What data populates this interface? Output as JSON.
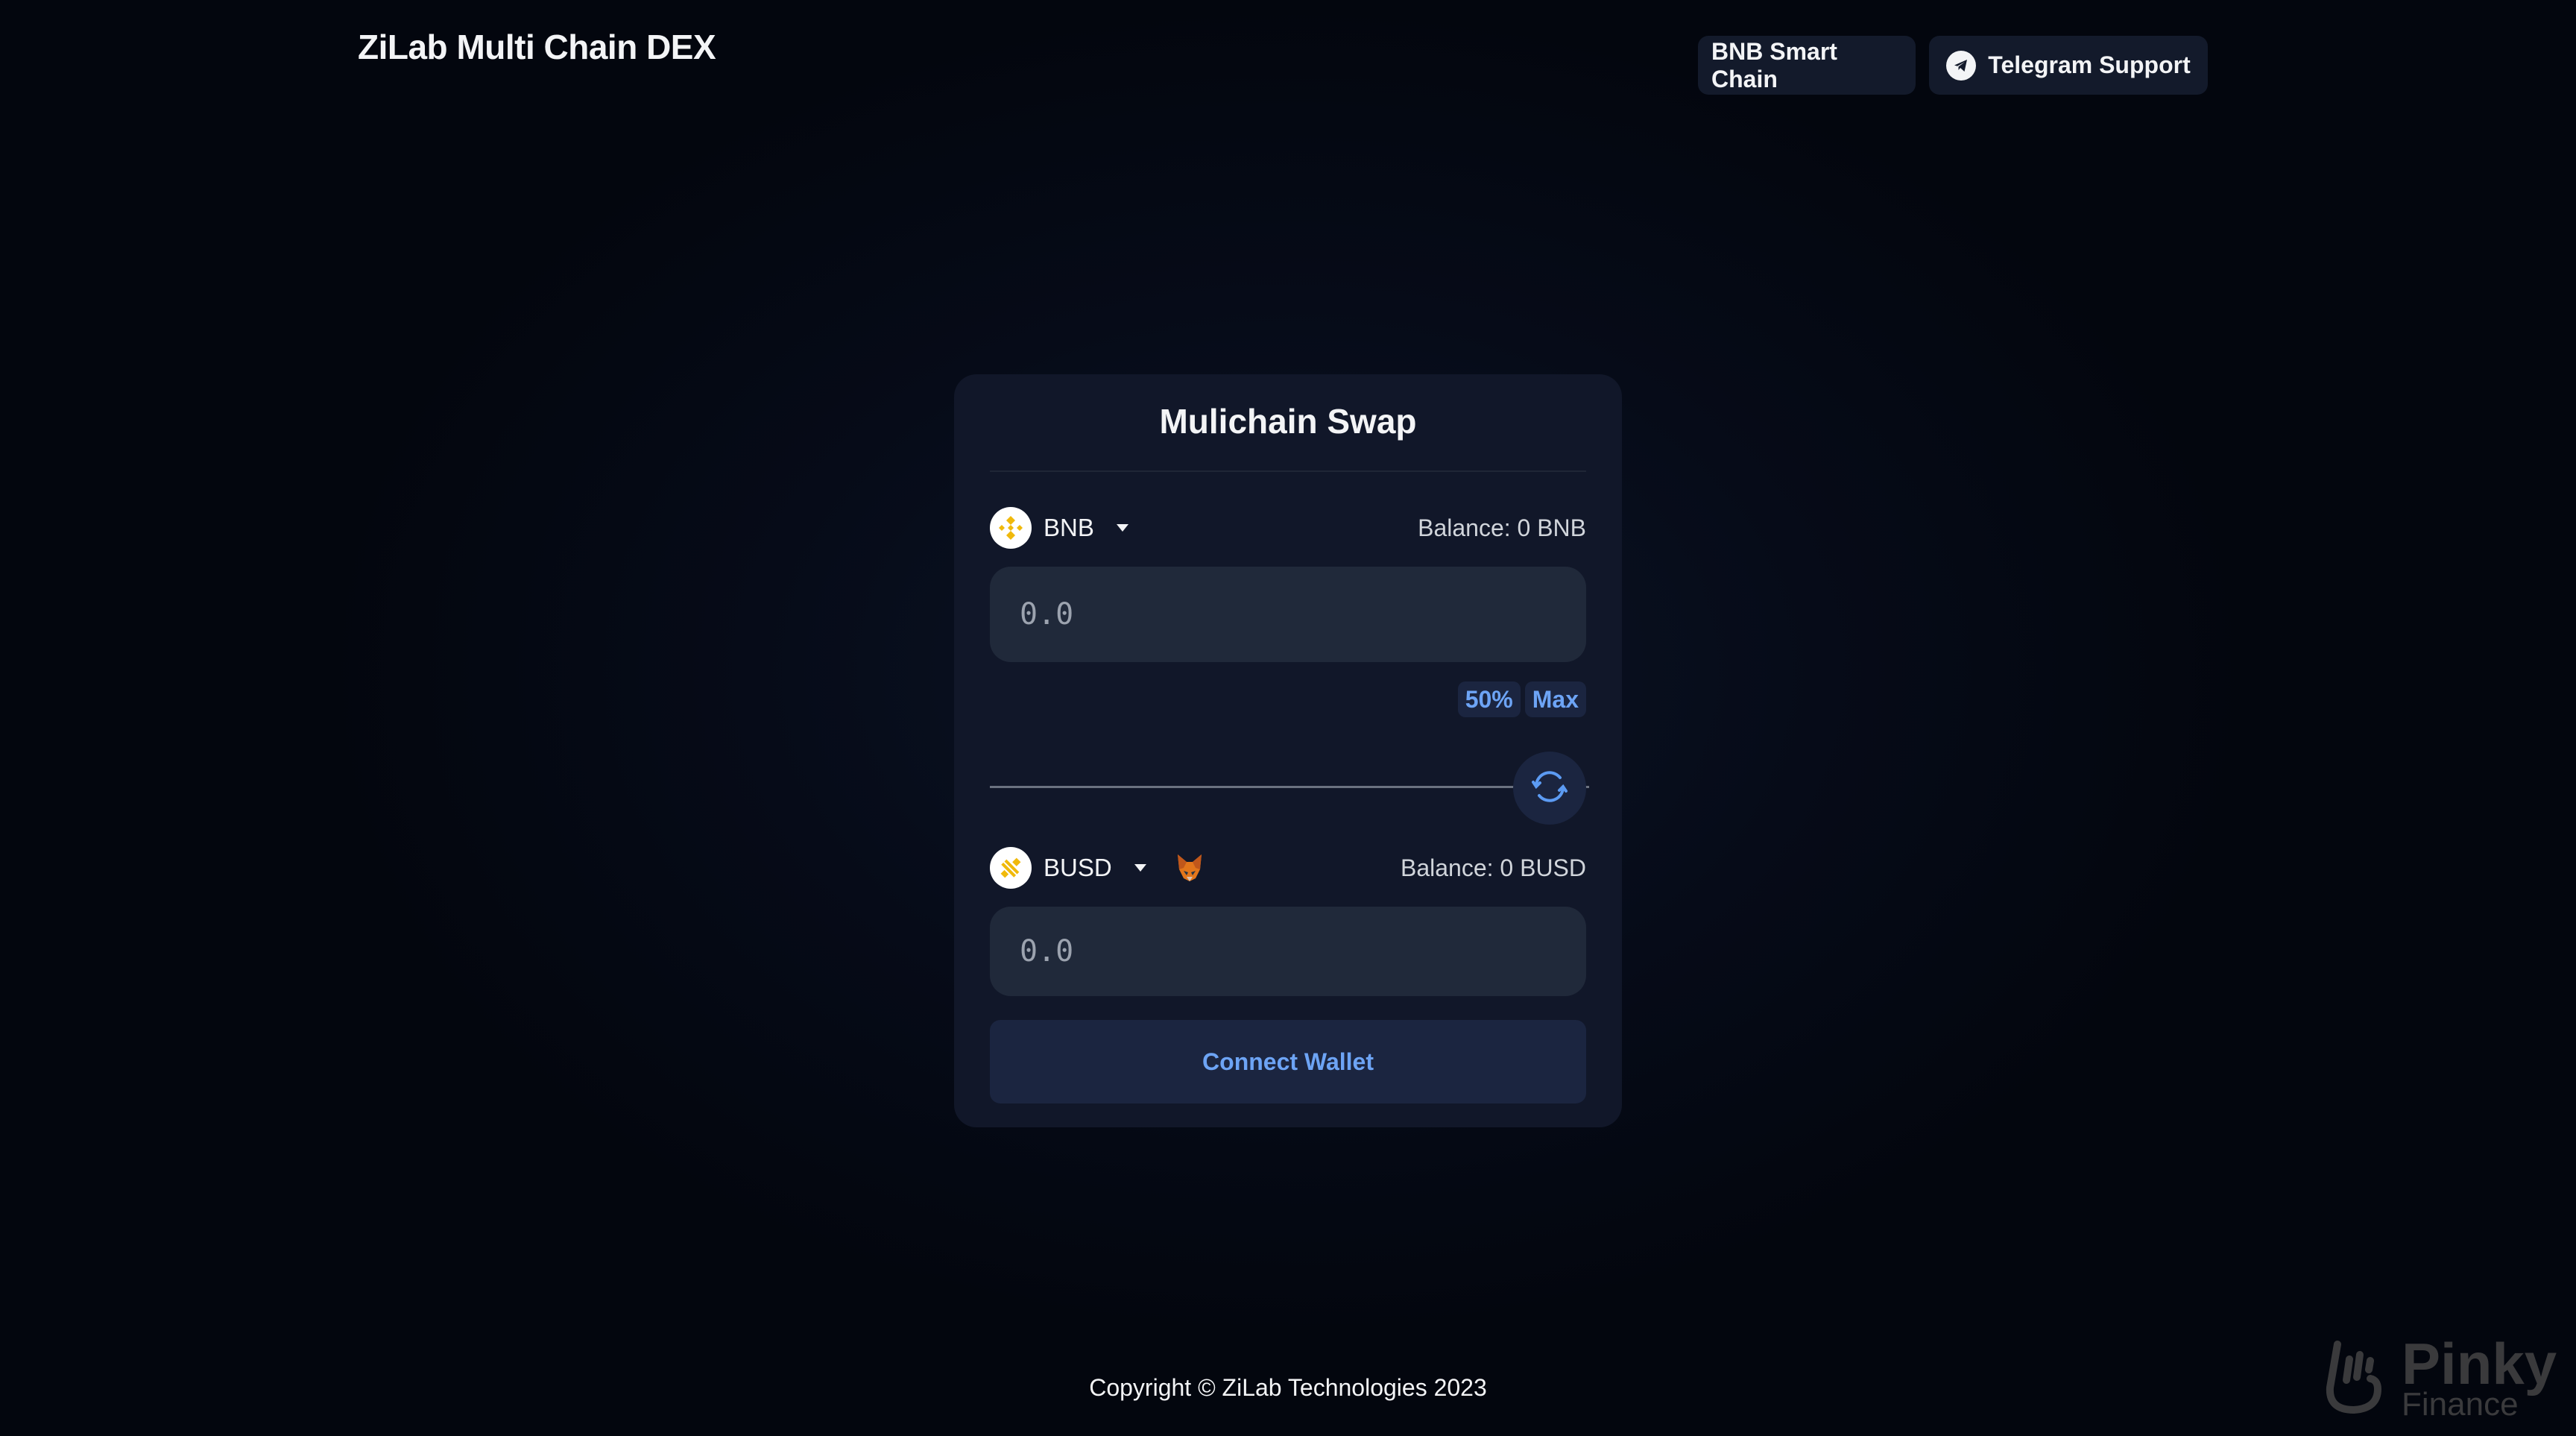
{
  "header": {
    "title": "ZiLab Multi Chain DEX",
    "network_button": "BNB Smart Chain",
    "support_button": "Telegram Support",
    "support_icon": "telegram-icon"
  },
  "swap": {
    "title": "Mulichain Swap",
    "from": {
      "token": "BNB",
      "token_icon": "bnb-logo-icon",
      "balance": "Balance: 0 BNB",
      "placeholder": "0.0"
    },
    "quick_amounts": [
      "50%",
      "Max"
    ],
    "switch_icon": "swap-arrows-icon",
    "to": {
      "token": "BUSD",
      "token_icon": "busd-logo-icon",
      "wallet_icon": "metamask-fox-icon",
      "balance": "Balance: 0 BUSD",
      "placeholder": "0.0"
    },
    "connect_button": "Connect Wallet"
  },
  "footer": {
    "copyright": "Copyright © ZiLab Technologies 2023"
  },
  "watermark": {
    "name": "Pinky",
    "sub": "Finance"
  },
  "colors": {
    "accent": "#6da4f5",
    "card_bg": "#111729",
    "input_bg": "#20293a",
    "button_bg": "#1b2540",
    "bnb_yellow": "#f0b90b"
  }
}
